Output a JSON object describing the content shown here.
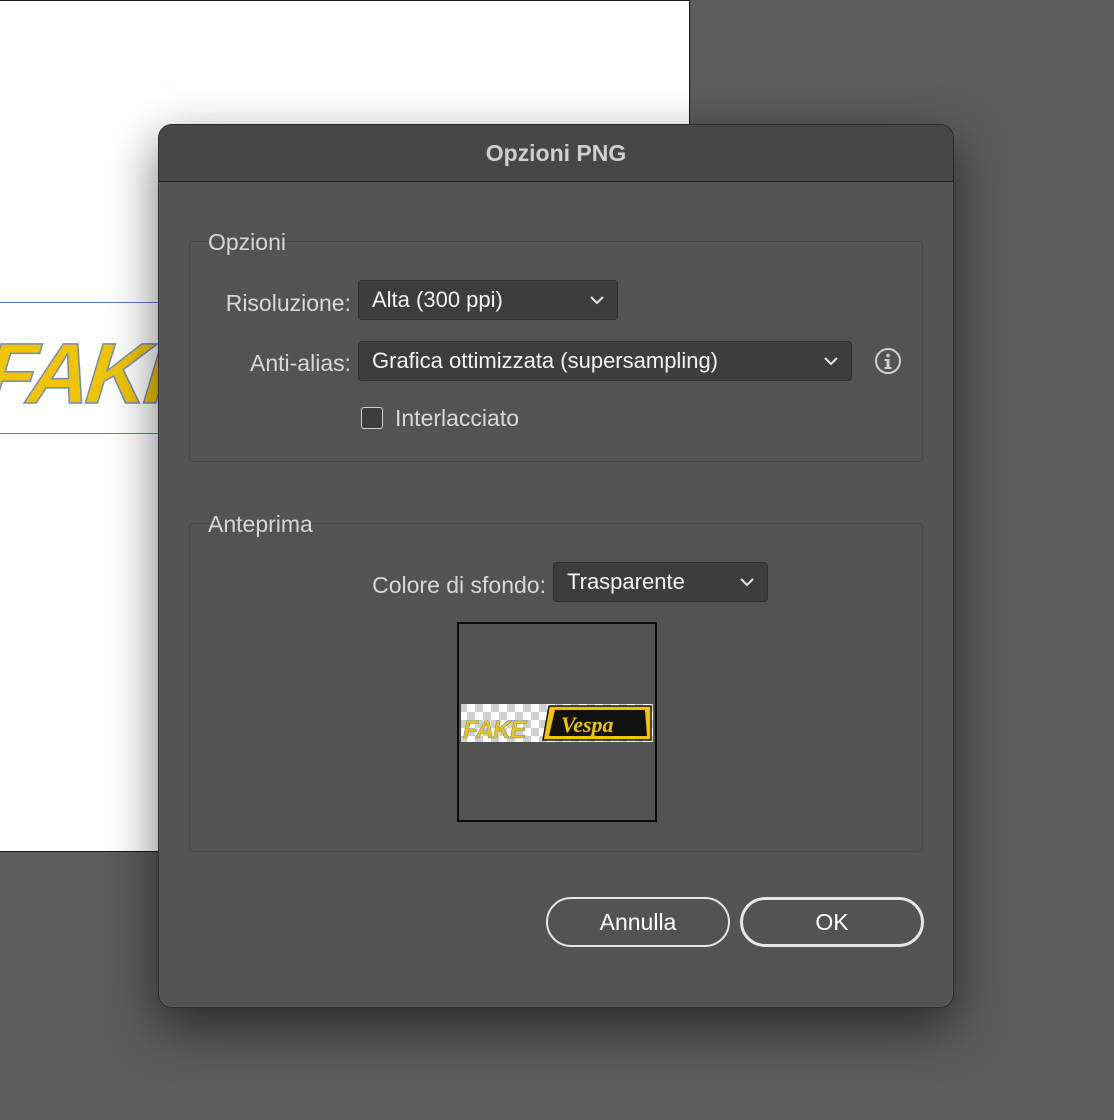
{
  "dialog": {
    "title": "Opzioni PNG",
    "options_group": {
      "legend": "Opzioni",
      "resolution_label": "Risoluzione:",
      "resolution_value": "Alta (300 ppi)",
      "antialias_label": "Anti-alias:",
      "antialias_value": "Grafica ottimizzata (supersampling)",
      "interlaced_label": "Interlacciato",
      "interlaced_checked": false
    },
    "preview_group": {
      "legend": "Anteprima",
      "background_label": "Colore di sfondo:",
      "background_value": "Trasparente",
      "preview_logo_text_left": "FAKE",
      "preview_logo_text_right": "Vespa"
    },
    "buttons": {
      "cancel": "Annulla",
      "ok": "OK"
    }
  },
  "artboard": {
    "text": "FAKI"
  },
  "icons": {
    "info": "info-icon",
    "chevron": "chevron-down-icon",
    "checkbox": "checkbox-icon"
  },
  "colors": {
    "dialog_bg": "#535353",
    "titlebar_bg": "#474747",
    "accent_yellow": "#f0c400"
  }
}
